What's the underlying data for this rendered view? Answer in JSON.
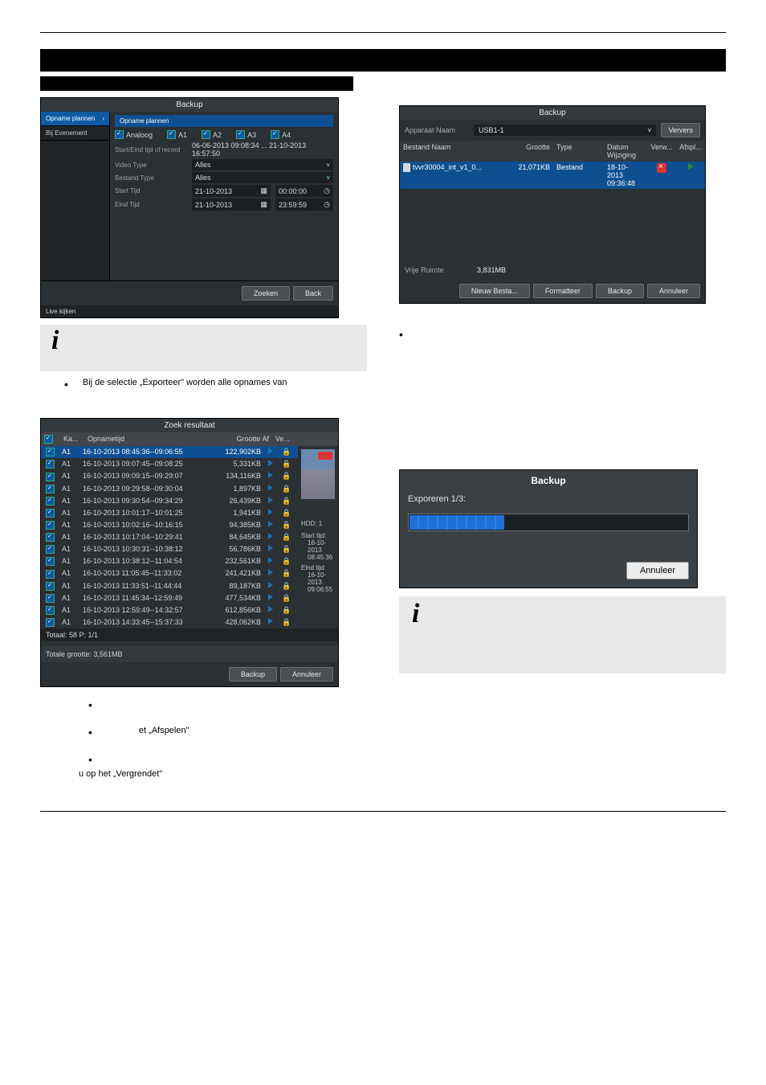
{
  "topbar": {
    "title_black": " "
  },
  "shot1": {
    "title": "Backup",
    "side": {
      "item1": "Opname plannen",
      "item2": "Bij Evenement",
      "sub": "Opname plannen"
    },
    "analog": {
      "label": "Analoog",
      "a1": "A1",
      "a2": "A2",
      "a3": "A3",
      "a4": "A4"
    },
    "range": {
      "label": "Start/Eind tijd of record",
      "value": "06-06-2013 09:08:34  ...  21-10-2013 16:57:50"
    },
    "video": {
      "label": "Video Type",
      "value": "Alles"
    },
    "file": {
      "label": "Bestand Type",
      "value": "Alles"
    },
    "start": {
      "label": "Start Tijd",
      "date": "21-10-2013",
      "time": "00:00:00"
    },
    "end": {
      "label": "Eind Tijd",
      "date": "21-10-2013",
      "time": "23:59:59"
    },
    "live": "Live kijken",
    "btn_search": "Zoeken",
    "btn_back": "Back"
  },
  "shot2": {
    "title": "Backup",
    "device_label": "Apparaat Naam",
    "device_value": "USB1-1",
    "refresh": "Ververs",
    "headers": {
      "name": "Bestand Naam",
      "size": "Grootte",
      "type": "Type",
      "date": "Datum Wijziging",
      "del": "Verw...",
      "play": "Afspl..."
    },
    "row": {
      "name": "tvvr30004_int_v1_0...",
      "size": "21,071KB",
      "type": "Bestand",
      "date": "18-10-2013 09:36:48"
    },
    "free_label": "Vrije Ruimte",
    "free_value": "3,831MB",
    "btn_new": "Nieuw Besta...",
    "btn_format": "Formatteer",
    "btn_backup": "Backup",
    "btn_cancel": "Annuleer"
  },
  "para_export": "Bij de selectie „Exporteer\" worden alle opnames van",
  "shot3": {
    "title": "Zoek resultaat",
    "headers": {
      "ka": "Ka...",
      "time": "Opnametijd",
      "size": "Grootte Af",
      "play": "Ve..."
    },
    "rows": [
      {
        "ch": "A1",
        "time": "16-10-2013 08:45:36--09:06:55",
        "size": "122,902KB"
      },
      {
        "ch": "A1",
        "time": "16-10-2013 09:07:45--09:08:25",
        "size": "5,331KB"
      },
      {
        "ch": "A1",
        "time": "16-10-2013 09:09:15--09:29:07",
        "size": "134,116KB"
      },
      {
        "ch": "A1",
        "time": "16-10-2013 09:29:58--09:30:04",
        "size": "1,897KB"
      },
      {
        "ch": "A1",
        "time": "16-10-2013 09:30:54--09:34:29",
        "size": "26,439KB"
      },
      {
        "ch": "A1",
        "time": "16-10-2013 10:01:17--10:01:25",
        "size": "1,941KB"
      },
      {
        "ch": "A1",
        "time": "16-10-2013 10:02:16--10:16:15",
        "size": "94,385KB"
      },
      {
        "ch": "A1",
        "time": "16-10-2013 10:17:04--10:29:41",
        "size": "84,645KB"
      },
      {
        "ch": "A1",
        "time": "16-10-2013 10:30:31--10:38:12",
        "size": "56,786KB"
      },
      {
        "ch": "A1",
        "time": "16-10-2013 10:38:12--11:04:54",
        "size": "232,561KB"
      },
      {
        "ch": "A1",
        "time": "16-10-2013 11:05:45--11:33:02",
        "size": "241,421KB"
      },
      {
        "ch": "A1",
        "time": "16-10-2013 11:33:51--11:44:44",
        "size": "89,187KB"
      },
      {
        "ch": "A1",
        "time": "16-10-2013 11:45:34--12:59:49",
        "size": "477,534KB"
      },
      {
        "ch": "A1",
        "time": "16-10-2013 12:59:49--14:32:57",
        "size": "612,856KB"
      },
      {
        "ch": "A1",
        "time": "16-10-2013 14:33:45--15:37:33",
        "size": "428,062KB"
      }
    ],
    "side": {
      "hdd": "HDD: 1",
      "start_label": "Start tijd:",
      "start_val": "16-10-2013 08:45:36",
      "end_label": "Eind tijd:",
      "end_val": "16-10-2013 09:06:55"
    },
    "totals": "Totaal: 58  P: 1/1",
    "totals2": "Totale grootte: 3,561MB",
    "btn_backup": "Backup",
    "btn_cancel": "Annuleer"
  },
  "shot4": {
    "title": "Backup",
    "label": "Exporeren 1/3:",
    "btn_cancel": "Annuleer"
  },
  "frag_afspelen": "et „Afspelen\"",
  "frag_vergrendet": "u op het „Vergrendet\""
}
